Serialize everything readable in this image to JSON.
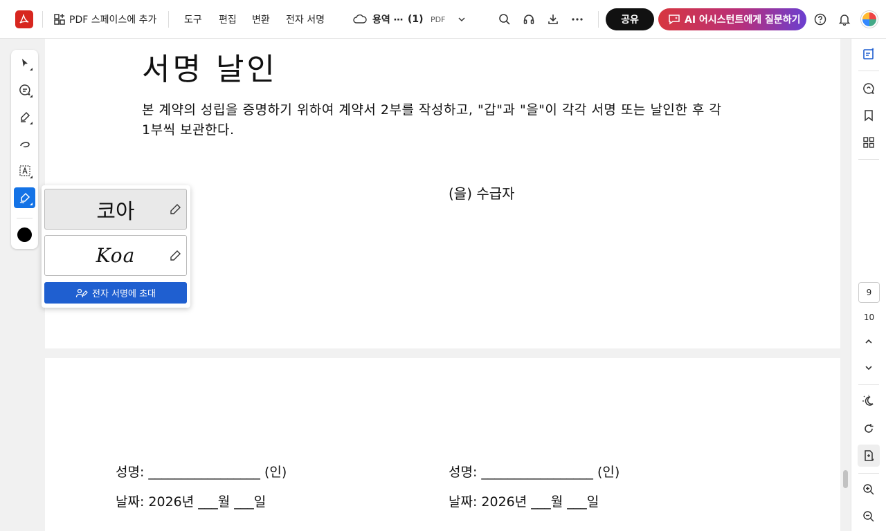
{
  "app": {
    "add_to_space": "PDF 스페이스에 추가",
    "menu": [
      "도구",
      "편집",
      "변환",
      "전자 서명"
    ],
    "file_name": "용역 ⋯",
    "file_suffix": "(1)",
    "file_type": "PDF",
    "share_label": "공유",
    "ai_label": "AI 어시스턴트에게 질문하기"
  },
  "document": {
    "heading": "서명 날인",
    "paragraph": "본 계약의 성립을 증명하기 위하여 계약서 2부를 작성하고, \"갑\"과 \"을\"이 각각 서명 또는 날인한 후 각 1부씩 보관한다.",
    "party_label": "(을) 수급자",
    "left_name_label": "성명: _________________ (인)",
    "left_date_label": "날짜: 2026년 ___월 ___일",
    "right_name_label": "성명: _________________ (인)",
    "right_date_label": "날짜: 2026년 ___월 ___일"
  },
  "signature_popup": {
    "signatures": [
      "코아",
      "Koa"
    ],
    "invite_label": "전자 서명에 초대"
  },
  "navigation": {
    "current_page": "9",
    "total_pages": "10"
  }
}
